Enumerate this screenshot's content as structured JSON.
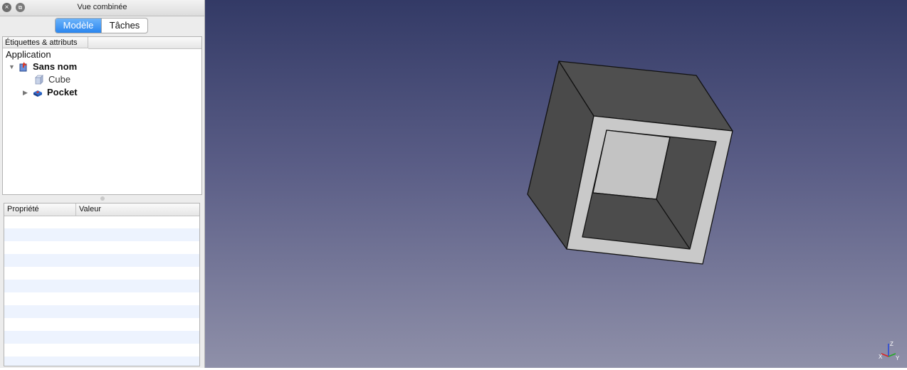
{
  "panel": {
    "title": "Vue combinée",
    "close_icon": "×",
    "float_icon": "⧉",
    "tabs": [
      {
        "label": "Modèle",
        "active": true
      },
      {
        "label": "Tâches",
        "active": false
      }
    ]
  },
  "tree": {
    "header": "Étiquettes & attributs",
    "root": "Application",
    "document": {
      "label": "Sans nom",
      "expanded": true,
      "arrow": "▼"
    },
    "items": [
      {
        "label": "Cube"
      },
      {
        "label": "Pocket",
        "arrow": "▶"
      }
    ]
  },
  "properties": {
    "columns": [
      "Propriété",
      "Valeur"
    ]
  },
  "viewport": {
    "background_top": "#333a66",
    "background_bottom": "#8f90a9",
    "axis_labels": {
      "x": "X",
      "y": "Y",
      "z": "Z"
    }
  }
}
